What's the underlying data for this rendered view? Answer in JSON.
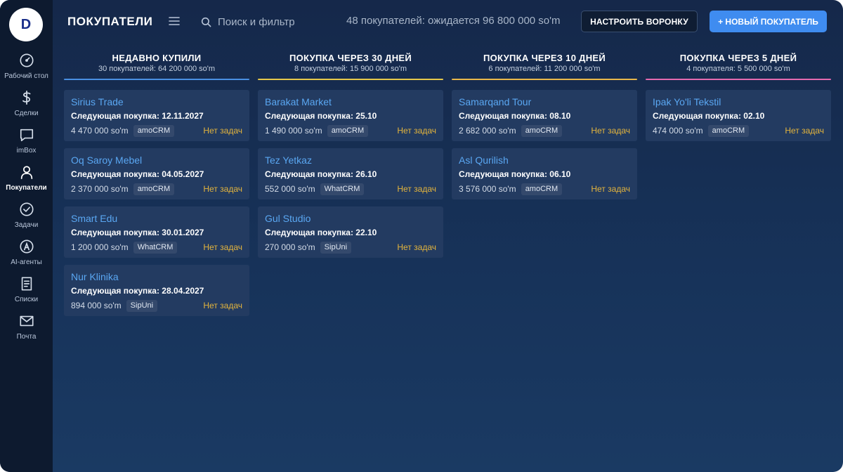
{
  "sidebar": {
    "logo": "D",
    "items": [
      {
        "label": "Рабочий стол",
        "icon": "speedometer-icon"
      },
      {
        "label": "Сделки",
        "icon": "dollar-icon"
      },
      {
        "label": "imBox",
        "icon": "chat-icon"
      },
      {
        "label": "Покупатели",
        "icon": "user-icon",
        "active": true
      },
      {
        "label": "Задачи",
        "icon": "check-circle-icon"
      },
      {
        "label": "AI-агенты",
        "icon": "ai-agent-icon"
      },
      {
        "label": "Списки",
        "icon": "list-icon"
      },
      {
        "label": "Почта",
        "icon": "mail-icon"
      }
    ]
  },
  "header": {
    "title": "ПОКУПАТЕЛИ",
    "search_placeholder": "Поиск и фильтр",
    "summary": "48 покупателей: ожидается 96 800 000 so'm",
    "funnel_button": "НАСТРОИТЬ ВОРОНКУ",
    "new_button": "+ НОВЫЙ ПОКУПАТЕЛЬ"
  },
  "columns": [
    {
      "title": "НЕДАВНО КУПИЛИ",
      "subtitle": "30 покупателей: 64 200 000 so'm",
      "color": "#4a90e2",
      "cards": [
        {
          "name": "Sirius Trade",
          "next": "Следующая покупка: 12.11.2027",
          "amount": "4 470 000 so'm",
          "tag": "amoCRM",
          "tasks": "Нет задач"
        },
        {
          "name": "Oq Saroy Mebel",
          "next": "Следующая покупка: 04.05.2027",
          "amount": "2 370 000 so'm",
          "tag": "amoCRM",
          "tasks": "Нет задач"
        },
        {
          "name": "Smart Edu",
          "next": "Следующая покупка: 30.01.2027",
          "amount": "1 200 000 so'm",
          "tag": "WhatCRM",
          "tasks": "Нет задач"
        },
        {
          "name": "Nur Klinika",
          "next": "Следующая покупка: 28.04.2027",
          "amount": "894 000 so'm",
          "tag": "SipUni",
          "tasks": "Нет задач"
        }
      ]
    },
    {
      "title": "ПОКУПКА ЧЕРЕЗ 30 ДНЕЙ",
      "subtitle": "8 покупателей: 15 900 000 so'm",
      "color": "#e5c84a",
      "cards": [
        {
          "name": "Barakat Market",
          "next": "Следующая покупка: 25.10",
          "amount": "1 490 000 so'm",
          "tag": "amoCRM",
          "tasks": "Нет задач"
        },
        {
          "name": "Tez Yetkaz",
          "next": "Следующая покупка: 26.10",
          "amount": "552 000 so'm",
          "tag": "WhatCRM",
          "tasks": "Нет задач"
        },
        {
          "name": "Gul Studio",
          "next": "Следующая покупка: 22.10",
          "amount": "270 000 so'm",
          "tag": "SipUni",
          "tasks": "Нет задач"
        }
      ]
    },
    {
      "title": "ПОКУПКА ЧЕРЕЗ 10 ДНЕЙ",
      "subtitle": "6 покупателей: 11 200 000 so'm",
      "color": "#e9b84a",
      "cards": [
        {
          "name": "Samarqand Tour",
          "next": "Следующая покупка: 08.10",
          "amount": "2 682 000 so'm",
          "tag": "amoCRM",
          "tasks": "Нет задач"
        },
        {
          "name": "Asl Qurilish",
          "next": "Следующая покупка: 06.10",
          "amount": "3 576 000 so'm",
          "tag": "amoCRM",
          "tasks": "Нет задач"
        }
      ]
    },
    {
      "title": "ПОКУПКА ЧЕРЕЗ 5 ДНЕЙ",
      "subtitle": "4 покупателя: 5 500 000 so'm",
      "color": "#e46ab0",
      "cards": [
        {
          "name": "Ipak Yo'li Tekstil",
          "next": "Следующая покупка: 02.10",
          "amount": "474 000 so'm",
          "tag": "amoCRM",
          "tasks": "Нет задач"
        }
      ]
    }
  ]
}
